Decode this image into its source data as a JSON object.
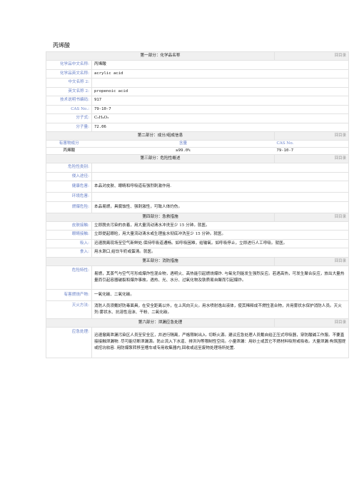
{
  "title": "丙烯酸",
  "back_link": "回目录",
  "sections": {
    "s1": "第一部分：化学品名称",
    "s2": "第二部分：成分/组成信息",
    "s3": "第三部分：危险性概述",
    "s4": "第四部分：急救措施",
    "s5": "第五部分：消防措施",
    "s6": "第六部分：泄漏应急处理"
  },
  "identity": [
    {
      "label": "化学品中文名称:",
      "value": "丙烯酸"
    },
    {
      "label": "化学品英文名称:",
      "value": "acrylic acid"
    },
    {
      "label": "中文名称 2:",
      "value": ""
    },
    {
      "label": "英文名称 2:",
      "value": "propenoic acid"
    },
    {
      "label": "技术说明书编码:",
      "value": "917"
    },
    {
      "label": "CAS No.:",
      "value": "79-10-7"
    },
    {
      "label": "分子式:",
      "value": "C₃H₄O₂"
    },
    {
      "label": "分子量:",
      "value": "72.06"
    }
  ],
  "composition": {
    "headers": [
      "有害物成分",
      "含量",
      "CAS No."
    ],
    "row": [
      "丙烯酸",
      "≥99.0%",
      "79-10-7"
    ]
  },
  "hazard": [
    {
      "label": "危险性类别:",
      "value": ""
    },
    {
      "label": "侵入途径:",
      "value": ""
    },
    {
      "label": "健康危害:",
      "value": "本品对皮肤、眼睛和呼吸道有强烈刺激作用."
    },
    {
      "label": "环境危害:",
      "value": ""
    },
    {
      "label": "燃爆危险:",
      "value": "本品易燃，具腐蚀性、强刺激性，可致人体灼伤。"
    }
  ],
  "firstaid": [
    {
      "label": "皮肤接触:",
      "value": "立即脱去污染的衣着，用大量流动清水冲洗至少 15 分钟。就医。"
    },
    {
      "label": "眼睛接触:",
      "value": "立即提起眼睑，用大量流动清水或生理盐水彻底冲洗至少 15 分钟。就医。"
    },
    {
      "label": "吸入:",
      "value": "迅速脱离现场至空气新鲜处.保持呼吸道通畅。如呼吸困难，给输氧。如呼吸停止，立即进行人工呼吸。就医。"
    },
    {
      "label": "食入:",
      "value": "用水漱口,给饮牛奶或蛋清。就医。"
    }
  ],
  "fire": [
    {
      "label": "危险特性:",
      "value": "易燃，其蒸气与空气可形成爆炸性混合物，遇明火、高热能引起燃烧爆炸. 与氧化剂能发生强烈反应。若遇高热，可发生聚合反应，放出大量热量而引起容器破裂和爆炸事故。遇热、光、水分、过氧化物及铁质易自聚而引起爆炸。"
    },
    {
      "label": "有害燃烧产物:",
      "value": "一氧化碳、二氧化碳。"
    },
    {
      "label": "灭火方法:",
      "value": "消防人员须戴好防毒面具，在安全距离以外，在上风向灭火。用水喷射逸出液体，使其稀释成不燃性混合物，并用雾状水保护消防人员。灭火剂:雾状水、抗溶性泡沫、干粉、二氧化碳。"
    }
  ],
  "spill": [
    {
      "label": "应急处理:",
      "value": "迅速撤离泄漏污染区人员至安全区，并进行隔离，严格限制出入. 切断火源。建议应急处理人员戴自给正压式呼吸器，穿防酸碱工作服。不要直接接触泄漏物. 尽可能切断泄漏源。防止流入下水道、排洪沟等限制性空间。小量泄漏：用砂土或其它不燃材料吸附或吸收。大量泄漏:构筑围堤或挖坑收容. 用防爆泵转移至槽车或专用收集器内,回收或运至废物处理场所处置."
    }
  ]
}
